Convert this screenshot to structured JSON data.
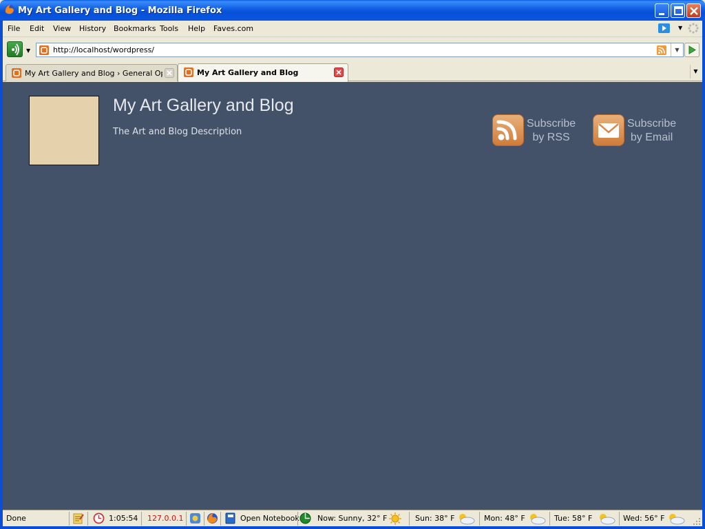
{
  "window": {
    "title": "My Art Gallery and Blog - Mozilla Firefox"
  },
  "menubar": {
    "items": [
      "File",
      "Edit",
      "View",
      "History",
      "Bookmarks",
      "Tools",
      "Help",
      "Faves.com"
    ]
  },
  "navbar": {
    "url": "http://localhost/wordpress/"
  },
  "tabs": [
    {
      "label": "My Art Gallery and Blog › General Opti...",
      "active": false
    },
    {
      "label": "My Art Gallery and Blog",
      "active": true
    }
  ],
  "page": {
    "blog_title": "My Art Gallery and Blog",
    "blog_description": "The Art and Blog Description",
    "subscribe_rss_line1": "Subscribe",
    "subscribe_rss_line2": "by RSS",
    "subscribe_email_line1": "Subscribe",
    "subscribe_email_line2": "by Email",
    "colors": {
      "background": "#435169",
      "logo_box": "#e5d1ab",
      "accent": "#d9894a"
    }
  },
  "statusbar": {
    "status": "Done",
    "clock": "1:05:54",
    "ip": "127.0.0.1",
    "notebook": "Open Notebook",
    "weather_now": "Now: Sunny, 32° F",
    "forecast": [
      {
        "label": "Sun: 38° F",
        "icon": "partly-cloudy-icon"
      },
      {
        "label": "Mon: 48° F",
        "icon": "partly-cloudy-icon"
      },
      {
        "label": "Tue: 58° F",
        "icon": "partly-cloudy-icon"
      },
      {
        "label": "Wed: 56° F",
        "icon": "partly-cloudy-icon"
      }
    ]
  }
}
